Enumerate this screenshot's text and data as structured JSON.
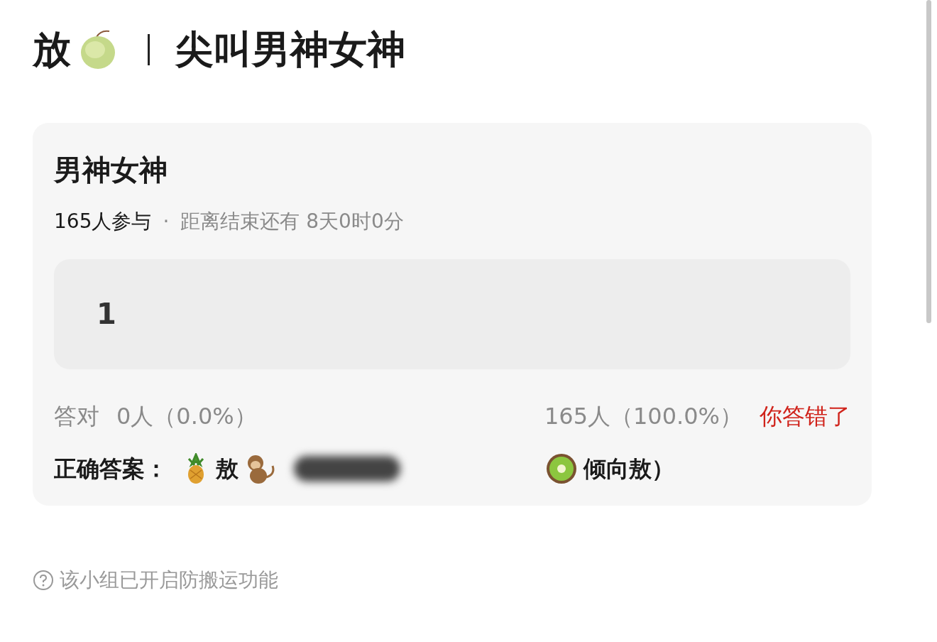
{
  "header": {
    "title_prefix": "放",
    "title": "尖叫男神女神"
  },
  "quiz": {
    "title": "男神女神",
    "participants": "165人参与",
    "separator": "·",
    "countdown": "距离结束还有 8天0时0分",
    "options": [
      {
        "label": "1"
      }
    ],
    "stats": {
      "correct_label": "答对",
      "correct_value": "0人（0.0%）",
      "wrong_value": "165人（100.0%）",
      "result": "你答错了"
    },
    "answer": {
      "label": "正确答案：",
      "parts": [
        {
          "kind": "pineapple"
        },
        {
          "kind": "text",
          "text": "敖"
        },
        {
          "kind": "monkey"
        },
        {
          "kind": "redacted"
        },
        {
          "kind": "kiwi"
        },
        {
          "kind": "text",
          "text": "倾向敖）"
        }
      ]
    }
  },
  "footer": {
    "notice": "该小组已开启防搬运功能"
  }
}
